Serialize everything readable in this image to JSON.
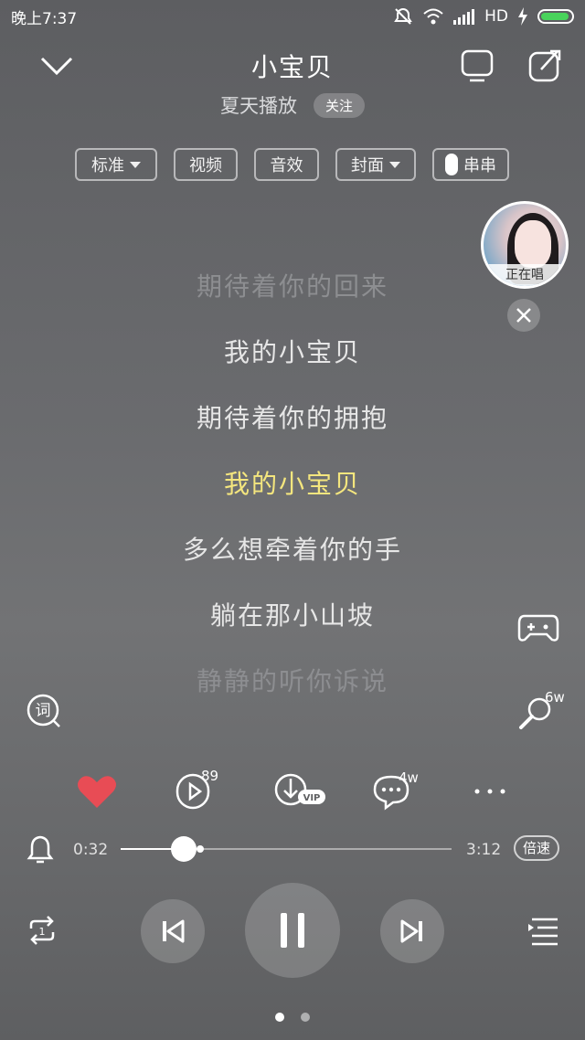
{
  "status_bar": {
    "time": "晚上7:37",
    "network": "HD",
    "icons": [
      "mute-icon",
      "wifi-icon",
      "signal-icon",
      "charging-icon",
      "battery-icon"
    ],
    "battery_level": 0.95,
    "battery_color": "#49d35b"
  },
  "header": {
    "title": "小宝贝",
    "artist": "夏天播放",
    "follow_label": "关注"
  },
  "options": {
    "quality": "标准",
    "video": "视频",
    "sound_effect": "音效",
    "cover": "封面",
    "chuanchuan": "串串"
  },
  "floating_card": {
    "label": "正在唱"
  },
  "lyrics": [
    {
      "text": "期待着你的回来",
      "state": "dim"
    },
    {
      "text": "我的小宝贝",
      "state": "normal"
    },
    {
      "text": "期待着你的拥抱",
      "state": "normal"
    },
    {
      "text": "我的小宝贝",
      "state": "active"
    },
    {
      "text": "多么想牵着你的手",
      "state": "normal"
    },
    {
      "text": "躺在那小山坡",
      "state": "normal"
    },
    {
      "text": "静静的听你诉说",
      "state": "dim"
    }
  ],
  "side": {
    "lyric_icon_label": "词",
    "mic_count": "6w"
  },
  "actions": {
    "play_count": "89",
    "comment_count": "4w",
    "vip_label": "VIP",
    "like_color": "#e84c55"
  },
  "progress": {
    "current": "0:32",
    "total": "3:12",
    "played_fraction": 0.19,
    "buffered_fraction": 0.24,
    "speed_label": "倍速"
  },
  "pager": {
    "pages": 2,
    "current": 1
  },
  "colors": {
    "active_lyric": "#f4e67e",
    "dim_lyric": "#8d8e91"
  }
}
